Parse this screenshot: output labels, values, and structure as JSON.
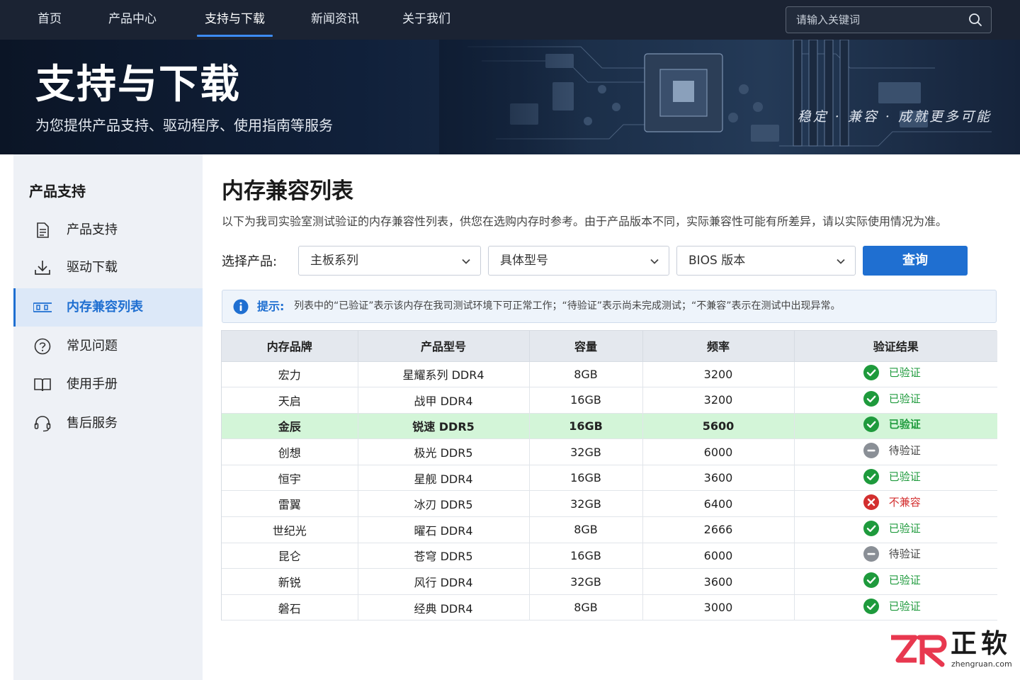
{
  "nav": {
    "items": [
      {
        "label": "首页"
      },
      {
        "label": "产品中心"
      },
      {
        "label": "支持与下载",
        "active": true
      },
      {
        "label": "新闻资讯"
      },
      {
        "label": "关于我们"
      }
    ],
    "search_placeholder": "请输入关键词"
  },
  "banner": {
    "title": "支持与下载",
    "subtitle": "为您提供产品支持、驱动程序、使用指南等服务",
    "slogan": "稳定 · 兼容 · 成就更多可能"
  },
  "sidebar": {
    "title": "产品支持",
    "items": [
      {
        "label": "产品支持",
        "icon": "document-icon"
      },
      {
        "label": "驱动下载",
        "icon": "download-icon"
      },
      {
        "label": "内存兼容列表",
        "icon": "memory-icon",
        "active": true
      },
      {
        "label": "常见问题",
        "icon": "question-icon"
      },
      {
        "label": "使用手册",
        "icon": "book-icon"
      },
      {
        "label": "售后服务",
        "icon": "headset-icon"
      }
    ]
  },
  "main": {
    "title": "内存兼容列表",
    "description": "以下为我司实验室测试验证的内存兼容性列表，供您在选购内存时参考。由于产品版本不同，实际兼容性可能有所差异，请以实际使用情况为准。",
    "filter": {
      "label": "选择产品:",
      "series": "主板系列",
      "model": "具体型号",
      "bios": "BIOS 版本",
      "query_button": "查询"
    },
    "notice": {
      "label": "提示:",
      "text": "列表中的“已验证”表示该内存在我司测试环境下可正常工作；“待验证”表示尚未完成测试；“不兼容”表示在测试中出现异常。"
    },
    "table": {
      "headers": [
        "内存品牌",
        "产品型号",
        "容量",
        "频率",
        "验证结果"
      ],
      "rows": [
        {
          "brand": "宏力",
          "model": "星耀系列 DDR4",
          "capacity": "8GB",
          "freq": "3200",
          "status": "已验证",
          "status_type": "verified"
        },
        {
          "brand": "天启",
          "model": "战甲 DDR4",
          "capacity": "16GB",
          "freq": "3200",
          "status": "已验证",
          "status_type": "verified"
        },
        {
          "brand": "金辰",
          "model": "锐速 DDR5",
          "capacity": "16GB",
          "freq": "5600",
          "status": "已验证",
          "status_type": "verified",
          "highlight": true
        },
        {
          "brand": "创想",
          "model": "极光 DDR5",
          "capacity": "32GB",
          "freq": "6000",
          "status": "待验证",
          "status_type": "pending"
        },
        {
          "brand": "恒宇",
          "model": "星舰 DDR4",
          "capacity": "16GB",
          "freq": "3600",
          "status": "已验证",
          "status_type": "verified"
        },
        {
          "brand": "雷翼",
          "model": "冰刃 DDR5",
          "capacity": "32GB",
          "freq": "6400",
          "status": "不兼容",
          "status_type": "incompatible"
        },
        {
          "brand": "世纪光",
          "model": "曜石 DDR4",
          "capacity": "8GB",
          "freq": "2666",
          "status": "已验证",
          "status_type": "verified"
        },
        {
          "brand": "昆仑",
          "model": "苍穹 DDR5",
          "capacity": "16GB",
          "freq": "6000",
          "status": "待验证",
          "status_type": "pending"
        },
        {
          "brand": "新锐",
          "model": "风行 DDR4",
          "capacity": "32GB",
          "freq": "3600",
          "status": "已验证",
          "status_type": "verified"
        },
        {
          "brand": "磐石",
          "model": "经典 DDR4",
          "capacity": "8GB",
          "freq": "3000",
          "status": "已验证",
          "status_type": "verified"
        }
      ]
    }
  },
  "watermark": {
    "logo_text": "ZR",
    "name": "正软",
    "url": "zhengruan.com"
  },
  "colors": {
    "accent": "#1f6fd1",
    "verified": "#1e9a3c",
    "incompatible": "#d32f2f",
    "pending": "#8a8f96",
    "highlight_row": "#d3f5d8"
  }
}
